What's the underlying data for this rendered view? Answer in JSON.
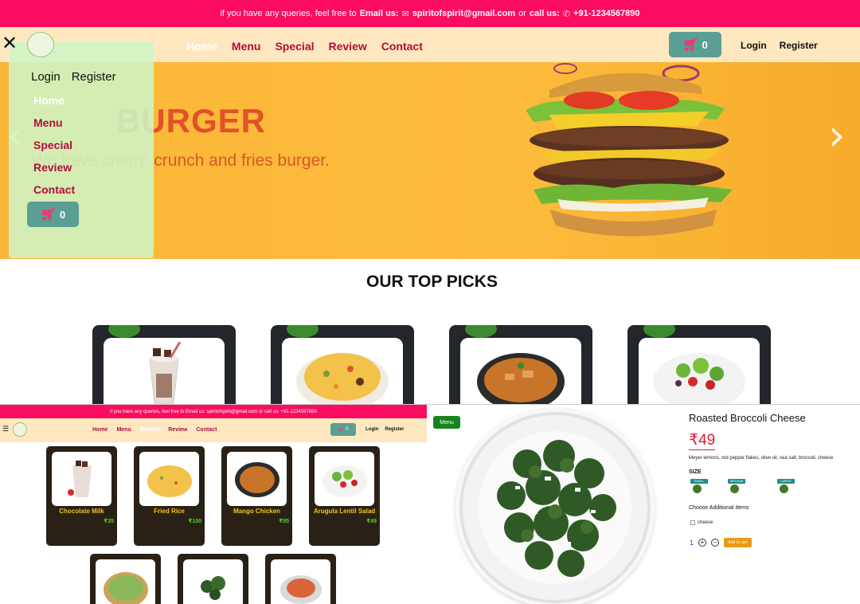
{
  "topbar": {
    "text_prefix": "if you have any queries, feel free to",
    "email_label": "Email us:",
    "email": "spiritofspirit@gmail.com",
    "or": "or",
    "call_label": "call us:",
    "phone": "+91-1234567890"
  },
  "nav": {
    "items": [
      "Home",
      "Menu",
      "Special",
      "Review",
      "Contact"
    ],
    "active": "Home",
    "cart_count": "0",
    "login": "Login",
    "register": "Register"
  },
  "hero": {
    "title": "BURGER",
    "subtitle": "We have crispy, crunch and fries burger."
  },
  "sidemenu": {
    "login": "Login",
    "register": "Register",
    "items": [
      "Home",
      "Menu",
      "Special",
      "Review",
      "Contact"
    ],
    "cart_count": "0"
  },
  "picks": {
    "title": "OUR TOP PICKS"
  },
  "mini_page": {
    "topbar": "if you have any queries, feel free to Email us: spiritofspirit@gmail.com or call us: +91-1234567890",
    "nav": [
      "Home",
      "Menu",
      "Special",
      "Review",
      "Contact"
    ],
    "cart_count": "0",
    "login": "Login",
    "register": "Register",
    "cards": [
      {
        "name": "Chocolate Milk",
        "price": "₹35"
      },
      {
        "name": "Fried Rice",
        "price": "₹100"
      },
      {
        "name": "Mango Chicken",
        "price": "₹95"
      },
      {
        "name": "Arugula Lentil Salad",
        "price": "₹49"
      }
    ]
  },
  "detail": {
    "menu_button": "Menu",
    "title": "Roasted Broccoli Cheese",
    "price": "₹49",
    "description": "Meyer lemons, red pepper flakes, olive oil, sea salt, broccoli, cheese",
    "size_label": "SIZE",
    "sizes": [
      "SMALL",
      "MEDIUM",
      "LARGE"
    ],
    "addons_label": "Choose Additional Items",
    "addons": [
      "cheese"
    ],
    "quantity": "1",
    "add_to_cart": "Add to cart"
  },
  "colors": {
    "primary": "#fa0d60",
    "nav_bg": "#ffe8c0",
    "link": "#b00c3c",
    "cart_btn": "#5a9e94",
    "hero_bg": "#fdbb3c"
  }
}
